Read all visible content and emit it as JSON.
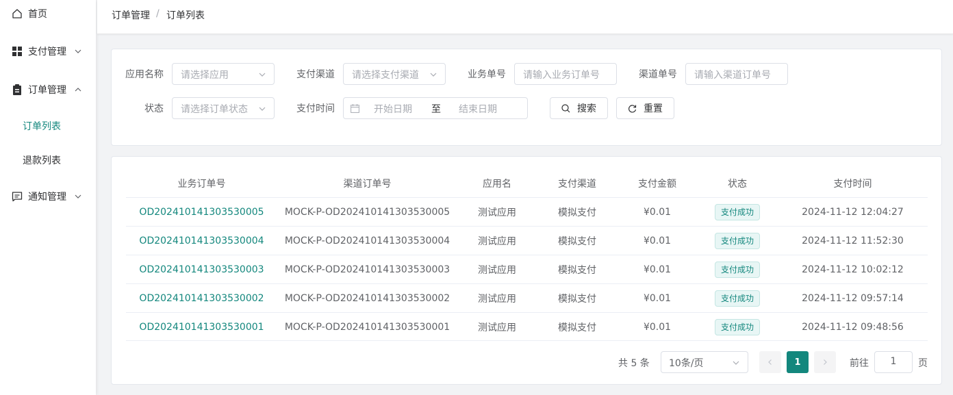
{
  "sidebar": {
    "home": "首页",
    "payment": "支付管理",
    "order": "订单管理",
    "order_list": "订单列表",
    "refund_list": "退款列表",
    "notify": "通知管理"
  },
  "breadcrumb": {
    "parent": "订单管理",
    "separator": "/",
    "current": "订单列表"
  },
  "search": {
    "app_label": "应用名称",
    "app_placeholder": "请选择应用",
    "channel_label": "支付渠道",
    "channel_placeholder": "请选择支付渠道",
    "biz_label": "业务单号",
    "biz_placeholder": "请输入业务订单号",
    "chan_no_label": "渠道单号",
    "chan_no_placeholder": "请输入渠道订单号",
    "status_label": "状态",
    "status_placeholder": "请选择订单状态",
    "time_label": "支付时间",
    "start_placeholder": "开始日期",
    "range_sep": "至",
    "end_placeholder": "结束日期",
    "search_btn": "搜索",
    "reset_btn": "重置"
  },
  "table": {
    "headers": [
      "业务订单号",
      "渠道订单号",
      "应用名",
      "支付渠道",
      "支付金额",
      "状态",
      "支付时间"
    ],
    "rows": [
      [
        "OD202410141303530005",
        "MOCK-P-OD202410141303530005",
        "测试应用",
        "模拟支付",
        "¥0.01",
        "支付成功",
        "2024-11-12 12:04:27"
      ],
      [
        "OD202410141303530004",
        "MOCK-P-OD202410141303530004",
        "测试应用",
        "模拟支付",
        "¥0.01",
        "支付成功",
        "2024-11-12 11:52:30"
      ],
      [
        "OD202410141303530003",
        "MOCK-P-OD202410141303530003",
        "测试应用",
        "模拟支付",
        "¥0.01",
        "支付成功",
        "2024-11-12 10:02:12"
      ],
      [
        "OD202410141303530002",
        "MOCK-P-OD202410141303530002",
        "测试应用",
        "模拟支付",
        "¥0.01",
        "支付成功",
        "2024-11-12 09:57:14"
      ],
      [
        "OD202410141303530001",
        "MOCK-P-OD202410141303530001",
        "测试应用",
        "模拟支付",
        "¥0.01",
        "支付成功",
        "2024-11-12 09:48:56"
      ]
    ]
  },
  "pagination": {
    "total": "共 5 条",
    "page_size": "10条/页",
    "current_page": "1",
    "goto_label": "前往",
    "goto_value": "1",
    "page_unit": "页"
  },
  "colors": {
    "accent": "#13877d",
    "badge_bg": "#e8f6f5"
  }
}
